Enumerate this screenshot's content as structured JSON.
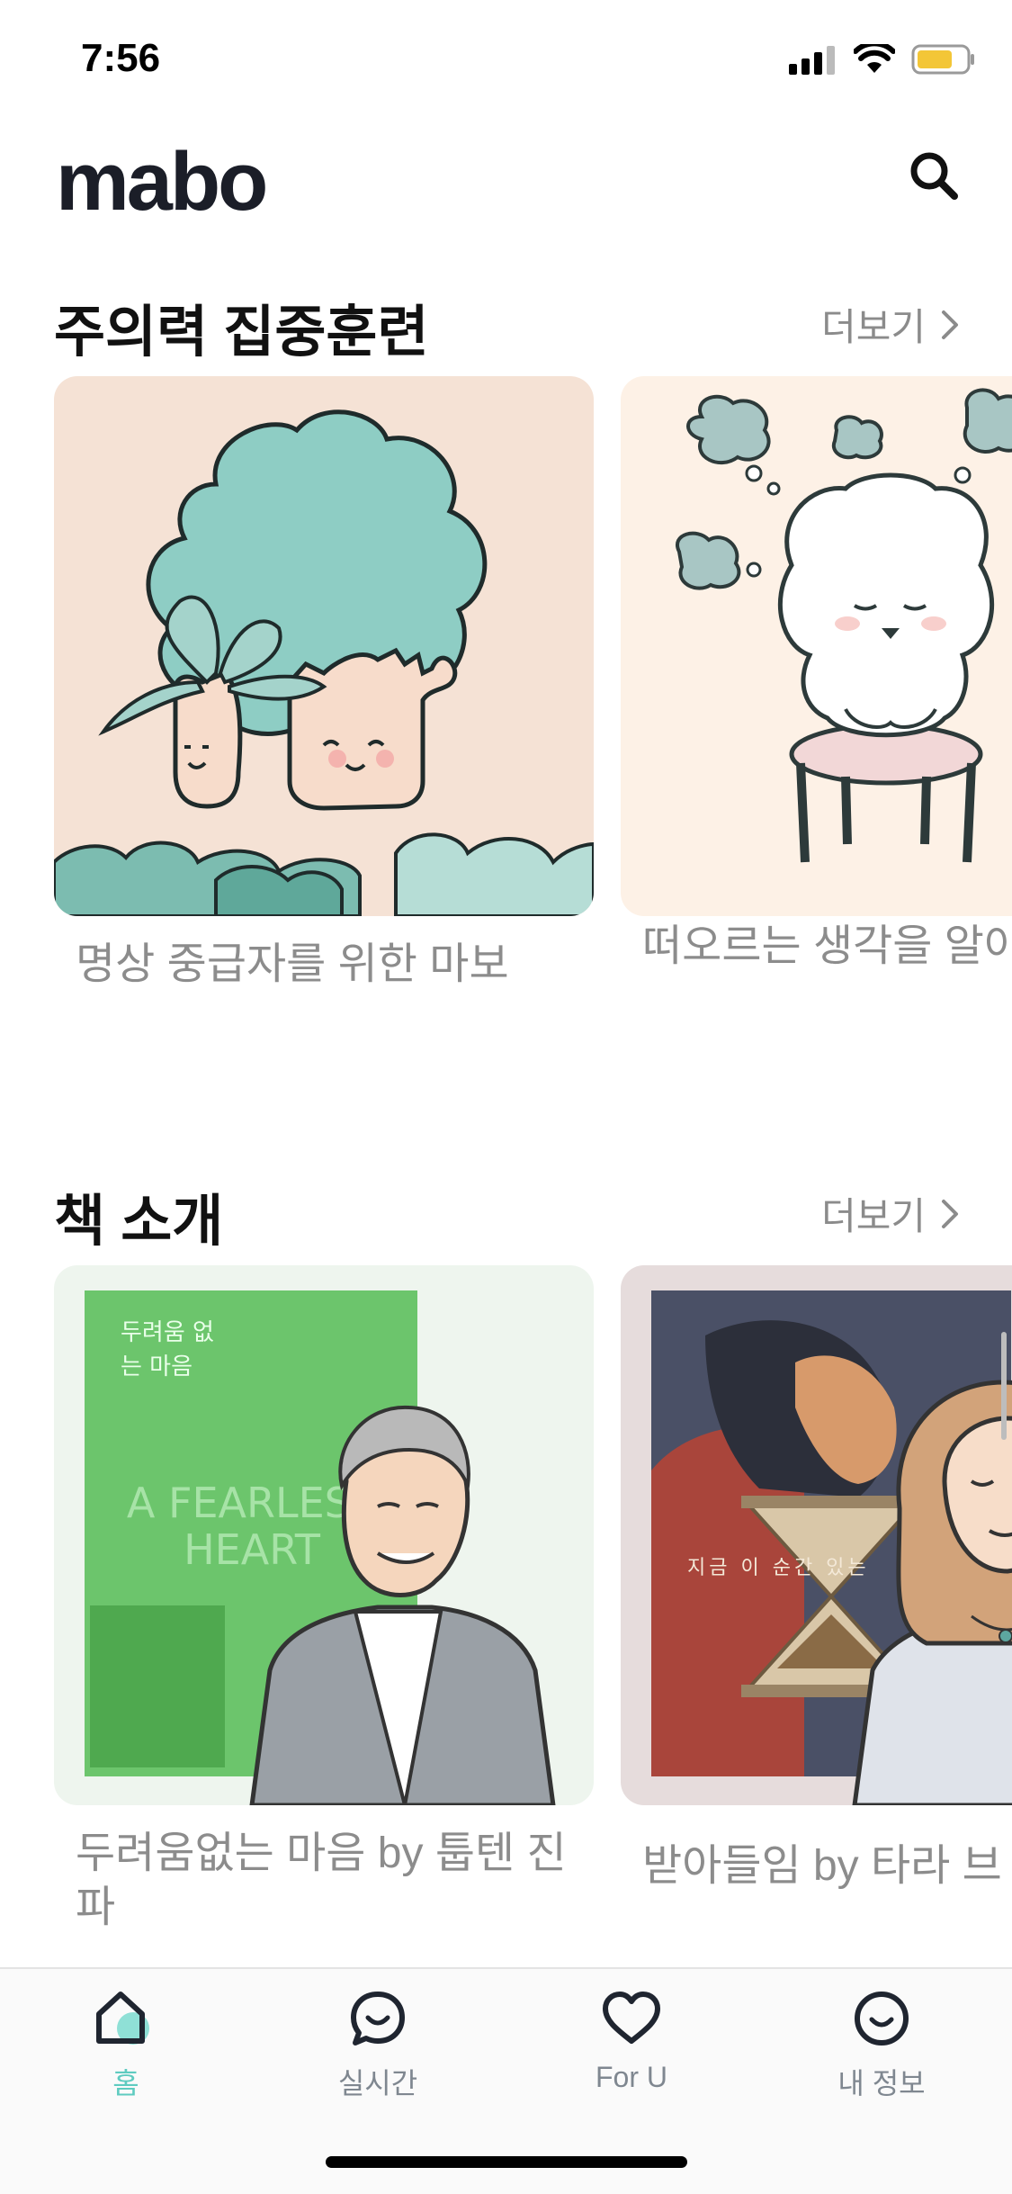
{
  "status_bar": {
    "time": "7:56"
  },
  "header": {
    "logo": "mabo",
    "search_icon": "search-icon"
  },
  "sections": [
    {
      "title": "주의력 집중훈련",
      "more_label": "더보기",
      "cards": [
        {
          "title": "명상 중급자를 위한 마보"
        },
        {
          "title": "떠오르는 생각을 알아차리기"
        }
      ]
    },
    {
      "title": "책 소개",
      "more_label": "더보기",
      "cards": [
        {
          "title": "두려움없는 마음 by 툽텐 진파",
          "book_title_kr": "두려움 없는 마음",
          "book_title_en": "A FEARLESS HEART"
        },
        {
          "title": "받아들임 by 타라 브",
          "book_subtitle": "지금 이 순간 있는"
        }
      ]
    }
  ],
  "tab_bar": {
    "tabs": [
      {
        "label": "홈",
        "icon": "home-icon",
        "active": true
      },
      {
        "label": "실시간",
        "icon": "chat-smile-icon",
        "active": false
      },
      {
        "label": "For U",
        "icon": "heart-icon",
        "active": false
      },
      {
        "label": "내 정보",
        "icon": "smile-icon",
        "active": false
      }
    ]
  },
  "colors": {
    "accent": "#5ecbc0",
    "muted_text": "#8c8c8c"
  }
}
